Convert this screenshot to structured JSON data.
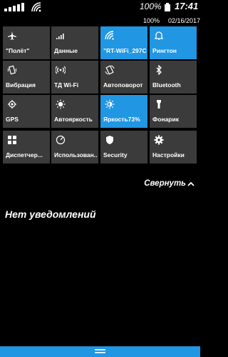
{
  "status_bar": {
    "battery_percent": "100%",
    "time": "17:41",
    "sub_percent": "100%",
    "date": "02/16/2017"
  },
  "tiles": [
    {
      "label": "\"Полёт\"",
      "icon": "airplane-icon",
      "active": false
    },
    {
      "label": "Данные",
      "icon": "cellular-data-icon",
      "active": false
    },
    {
      "label": "\"RT-WiFi_297C\"",
      "icon": "wifi-icon",
      "active": true
    },
    {
      "label": "Рингтон",
      "icon": "bell-icon",
      "active": true
    },
    {
      "label": "Вибрация",
      "icon": "vibration-icon",
      "active": false
    },
    {
      "label": "ТД Wi-Fi",
      "icon": "hotspot-icon",
      "active": false
    },
    {
      "label": "Автоповорот",
      "icon": "rotate-icon",
      "active": false
    },
    {
      "label": "Bluetooth",
      "icon": "bluetooth-icon",
      "active": false
    },
    {
      "label": "GPS",
      "icon": "location-icon",
      "active": false
    },
    {
      "label": "Автояркость",
      "icon": "auto-brightness-icon",
      "active": false
    },
    {
      "label": "Яркость73%",
      "icon": "brightness-icon",
      "active": true
    },
    {
      "label": "Фонарик",
      "icon": "flashlight-icon",
      "active": false
    },
    {
      "label": "Диспетчер...",
      "icon": "grid-icon",
      "active": false
    },
    {
      "label": "Использован...",
      "icon": "speedometer-icon",
      "active": false
    },
    {
      "label": "Security",
      "icon": "shield-icon",
      "active": false
    },
    {
      "label": "Настройки",
      "icon": "gear-icon",
      "active": false
    }
  ],
  "collapse_label": "Свернуть",
  "empty_message": "Нет уведомлений",
  "colors": {
    "accent": "#2196e3",
    "tile": "#3b3b3b",
    "background": "#000000"
  }
}
